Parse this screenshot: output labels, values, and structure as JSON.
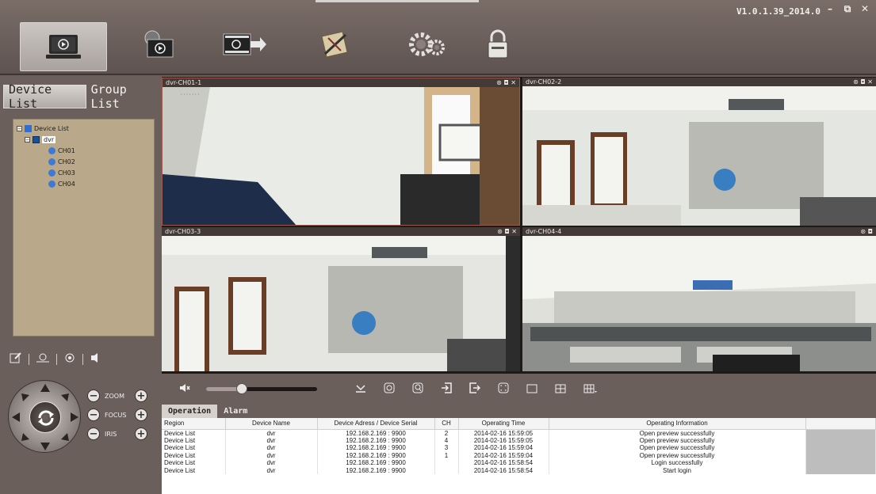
{
  "app": {
    "version": "V1.0.1.39_2014.0",
    "window_controls": [
      "–",
      "⧉",
      "✕"
    ]
  },
  "toolbar": {
    "buttons": [
      {
        "name": "preview",
        "icon": "monitor-play-icon",
        "active": true
      },
      {
        "name": "playback",
        "icon": "film-reel-icon",
        "active": false
      },
      {
        "name": "record-export",
        "icon": "film-export-icon",
        "active": false
      },
      {
        "name": "e-map",
        "icon": "map-tools-icon",
        "active": false
      },
      {
        "name": "settings",
        "icon": "gears-icon",
        "active": false
      },
      {
        "name": "lock",
        "icon": "padlock-icon",
        "active": false
      }
    ]
  },
  "left": {
    "tabs": [
      {
        "label": "Device List",
        "selected": true
      },
      {
        "label": "Group List",
        "selected": false
      }
    ],
    "tree": {
      "root": "Device List",
      "device": "dvr",
      "channels": [
        "CH01",
        "CH02",
        "CH03",
        "CH04"
      ]
    },
    "tools": [
      "edit-icon",
      "center-icon",
      "snapshot-icon",
      "audio-icon"
    ],
    "ptz": {
      "zoom_label": "ZOOM",
      "focus_label": "FOCUS",
      "iris_label": "IRIS",
      "minus": "−",
      "plus": "+"
    }
  },
  "video": {
    "panes": [
      {
        "title": "dvr-CH01-1",
        "controls": "⊛ ◘ ✕"
      },
      {
        "title": "dvr-CH02-2",
        "controls": "⊛ ◘ ✕"
      },
      {
        "title": "dvr-CH03-3",
        "controls": "⊛ ◘ ✕"
      },
      {
        "title": "dvr-CH04-4",
        "controls": "⊛ ◘"
      }
    ]
  },
  "controls": {
    "mute_icon": "speaker-mute-icon",
    "volume": 0.32,
    "buttons": [
      "download-icon",
      "record-icon",
      "zoom-in-icon",
      "import-icon",
      "export-icon",
      "fullscreen-icon",
      "single-view-icon",
      "quad-view-icon",
      "multi-view-icon"
    ]
  },
  "log": {
    "tabs": [
      {
        "label": "Operation",
        "selected": true
      },
      {
        "label": "Alarm",
        "selected": false
      }
    ],
    "columns": [
      "Region",
      "Device Name",
      "Device Adress / Device Serial",
      "CH",
      "Operating Time",
      "Operating Information"
    ],
    "rows": [
      [
        "Device List",
        "dvr",
        "192.168.2.169 : 9900",
        "2",
        "2014-02-16 15:59:05",
        "Open preview successfully"
      ],
      [
        "Device List",
        "dvr",
        "192.168.2.169 : 9900",
        "4",
        "2014-02-16 15:59:05",
        "Open preview successfully"
      ],
      [
        "Device List",
        "dvr",
        "192.168.2.169 : 9900",
        "3",
        "2014-02-16 15:59:04",
        "Open preview successfully"
      ],
      [
        "Device List",
        "dvr",
        "192.168.2.169 : 9900",
        "1",
        "2014-02-16 15:59:04",
        "Open preview successfully"
      ],
      [
        "Device List",
        "dvr",
        "192.168.2.169 : 9900",
        "",
        "2014-02-16 15:58:54",
        "Login successfully"
      ],
      [
        "Device List",
        "dvr",
        "192.168.2.169 : 9900",
        "",
        "2014-02-16 15:58:54",
        "Start login"
      ]
    ]
  }
}
